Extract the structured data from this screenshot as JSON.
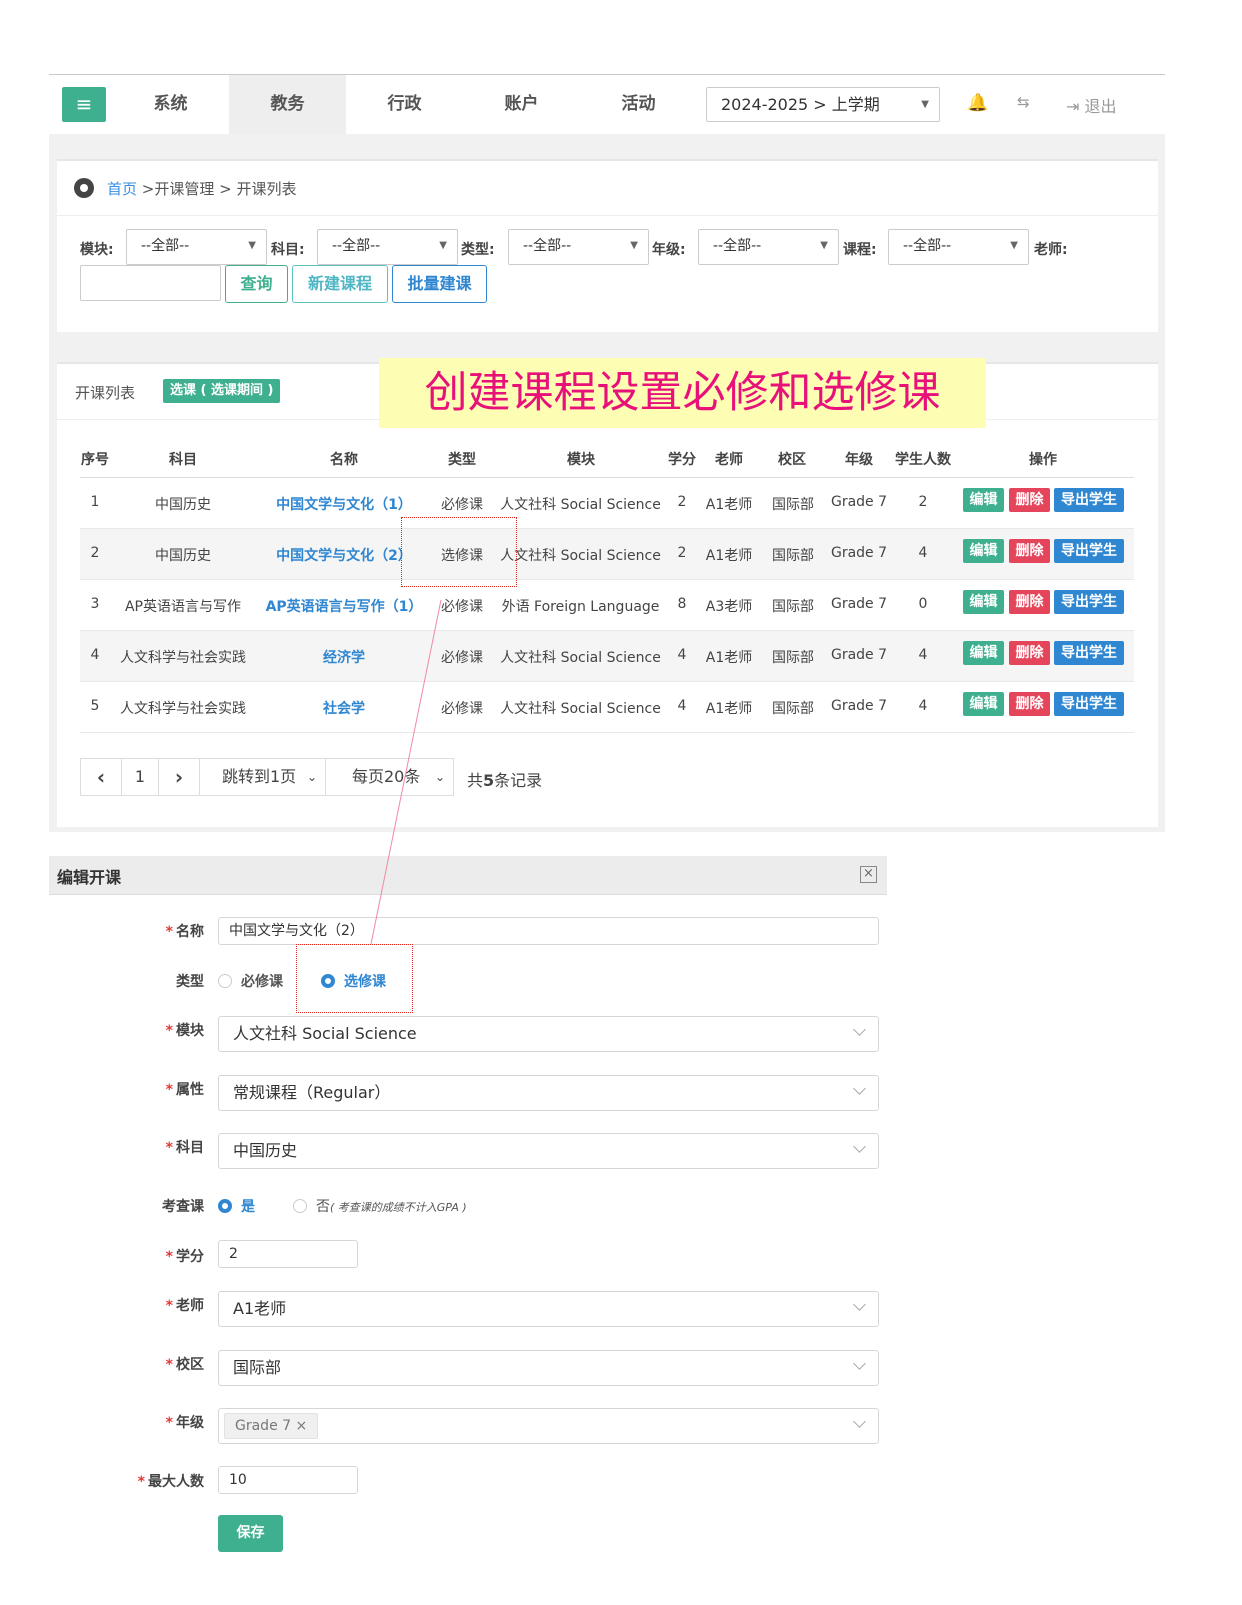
{
  "nav": {
    "menu_icon": "hamburger-icon",
    "tabs": [
      "系统",
      "教务",
      "行政",
      "账户",
      "活动"
    ],
    "active_tab": "教务",
    "term": "2024-2025 > 上学期",
    "logout": "退出"
  },
  "breadcrumb": {
    "home": "首页",
    "rest": " >开课管理 > 开课列表"
  },
  "filters": {
    "module_label": "模块:",
    "subject_label": "科目:",
    "type_label": "类型:",
    "grade_label": "年级:",
    "course_label": "课程:",
    "teacher_label": "老师:",
    "all": "--全部--",
    "query": "查询",
    "new_course": "新建课程",
    "batch_course": "批量建课"
  },
  "list": {
    "title": "开课列表",
    "badge": "选课 ( 选课期间 )",
    "annotation": "创建课程设置必修和选修课",
    "headers": [
      "序号",
      "科目",
      "名称",
      "类型",
      "模块",
      "学分",
      "老师",
      "校区",
      "年级",
      "学生人数",
      "操作"
    ],
    "rows": [
      [
        "1",
        "中国历史",
        "中国文学与文化（1）",
        "必修课",
        "人文社科 Social Science",
        "2",
        "A1老师",
        "国际部",
        "Grade 7",
        "2"
      ],
      [
        "2",
        "中国历史",
        "中国文学与文化（2）",
        "选修课",
        "人文社科 Social Science",
        "2",
        "A1老师",
        "国际部",
        "Grade 7",
        "4"
      ],
      [
        "3",
        "AP英语语言与写作",
        "AP英语语言与写作（1）",
        "必修课",
        "外语 Foreign Language",
        "8",
        "A3老师",
        "国际部",
        "Grade 7",
        "0"
      ],
      [
        "4",
        "人文科学与社会实践",
        "经济学",
        "必修课",
        "人文社科 Social Science",
        "4",
        "A1老师",
        "国际部",
        "Grade 7",
        "4"
      ],
      [
        "5",
        "人文科学与社会实践",
        "社会学",
        "必修课",
        "人文社科 Social Science",
        "4",
        "A1老师",
        "国际部",
        "Grade 7",
        "4"
      ]
    ],
    "actions": {
      "edit": "编辑",
      "delete": "删除",
      "export": "导出学生"
    },
    "colors": {
      "edit": "#3fb08f",
      "delete": "#e5455a",
      "export": "#2f86d1"
    }
  },
  "pager": {
    "prev": "‹",
    "page": "1",
    "next": "›",
    "jump": "跳转到1页",
    "per_page": "每页20条",
    "total_prefix": "共",
    "total_count": "5",
    "total_suffix": "条记录"
  },
  "modal": {
    "title": "编辑开课",
    "close": "×",
    "name_label": "名称",
    "name_value": "中国文学与文化（2）",
    "type_label": "类型",
    "type_required": "必修课",
    "type_elective": "选修课",
    "module_label": "模块",
    "module_value": "人文社科 Social Science",
    "attr_label": "属性",
    "attr_value": "常规课程（Regular）",
    "subject_label": "科目",
    "subject_value": "中国历史",
    "exam_label": "考查课",
    "exam_yes": "是",
    "exam_no": "否",
    "exam_note": "( 考查课的成绩不计入GPA )",
    "credit_label": "学分",
    "credit_value": "2",
    "teacher_label": "老师",
    "teacher_value": "A1老师",
    "campus_label": "校区",
    "campus_value": "国际部",
    "grade_label": "年级",
    "grade_tag": "Grade 7",
    "max_label": "最大人数",
    "max_value": "10",
    "save": "保存"
  }
}
